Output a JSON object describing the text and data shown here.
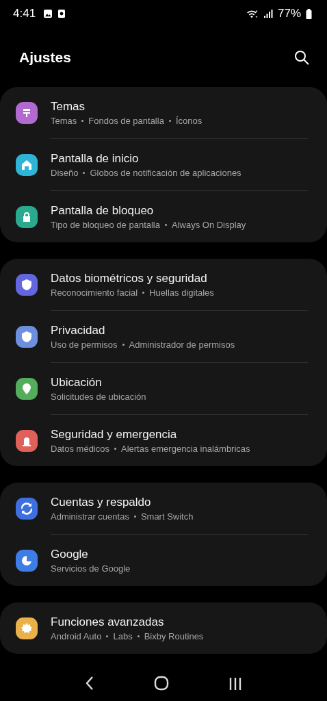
{
  "status_bar": {
    "time": "4:41",
    "battery": "77%"
  },
  "header": {
    "title": "Ajustes"
  },
  "groups": [
    {
      "items": [
        {
          "title": "Temas",
          "subtitle": [
            "Temas",
            "Fondos de pantalla",
            "Íconos"
          ],
          "color": "#b06ad0"
        },
        {
          "title": "Pantalla de inicio",
          "subtitle": [
            "Diseño",
            "Globos de notificación de aplicaciones"
          ],
          "color": "#2fb4d6"
        },
        {
          "title": "Pantalla de bloqueo",
          "subtitle": [
            "Tipo de bloqueo de pantalla",
            "Always On Display"
          ],
          "color": "#2aa98f"
        }
      ]
    },
    {
      "items": [
        {
          "title": "Datos biométricos y seguridad",
          "subtitle": [
            "Reconocimiento facial",
            "Huellas digitales"
          ],
          "color": "#6466e0"
        },
        {
          "title": "Privacidad",
          "subtitle": [
            "Uso de permisos",
            "Administrador de permisos"
          ],
          "color": "#6d8fe0"
        },
        {
          "title": "Ubicación",
          "subtitle": [
            "Solicitudes de ubicación"
          ],
          "color": "#54ad5b"
        },
        {
          "title": "Seguridad y emergencia",
          "subtitle": [
            "Datos médicos",
            "Alertas emergencia inalámbricas"
          ],
          "color": "#e0605a"
        }
      ]
    },
    {
      "items": [
        {
          "title": "Cuentas y respaldo",
          "subtitle": [
            "Administrar cuentas",
            "Smart Switch"
          ],
          "color": "#3d6fe0"
        },
        {
          "title": "Google",
          "subtitle": [
            "Servicios de Google"
          ],
          "color": "#3f7de6"
        }
      ]
    },
    {
      "items": [
        {
          "title": "Funciones avanzadas",
          "subtitle": [
            "Android Auto",
            "Labs",
            "Bixby Routines"
          ],
          "color": "#eab04a"
        }
      ]
    }
  ]
}
